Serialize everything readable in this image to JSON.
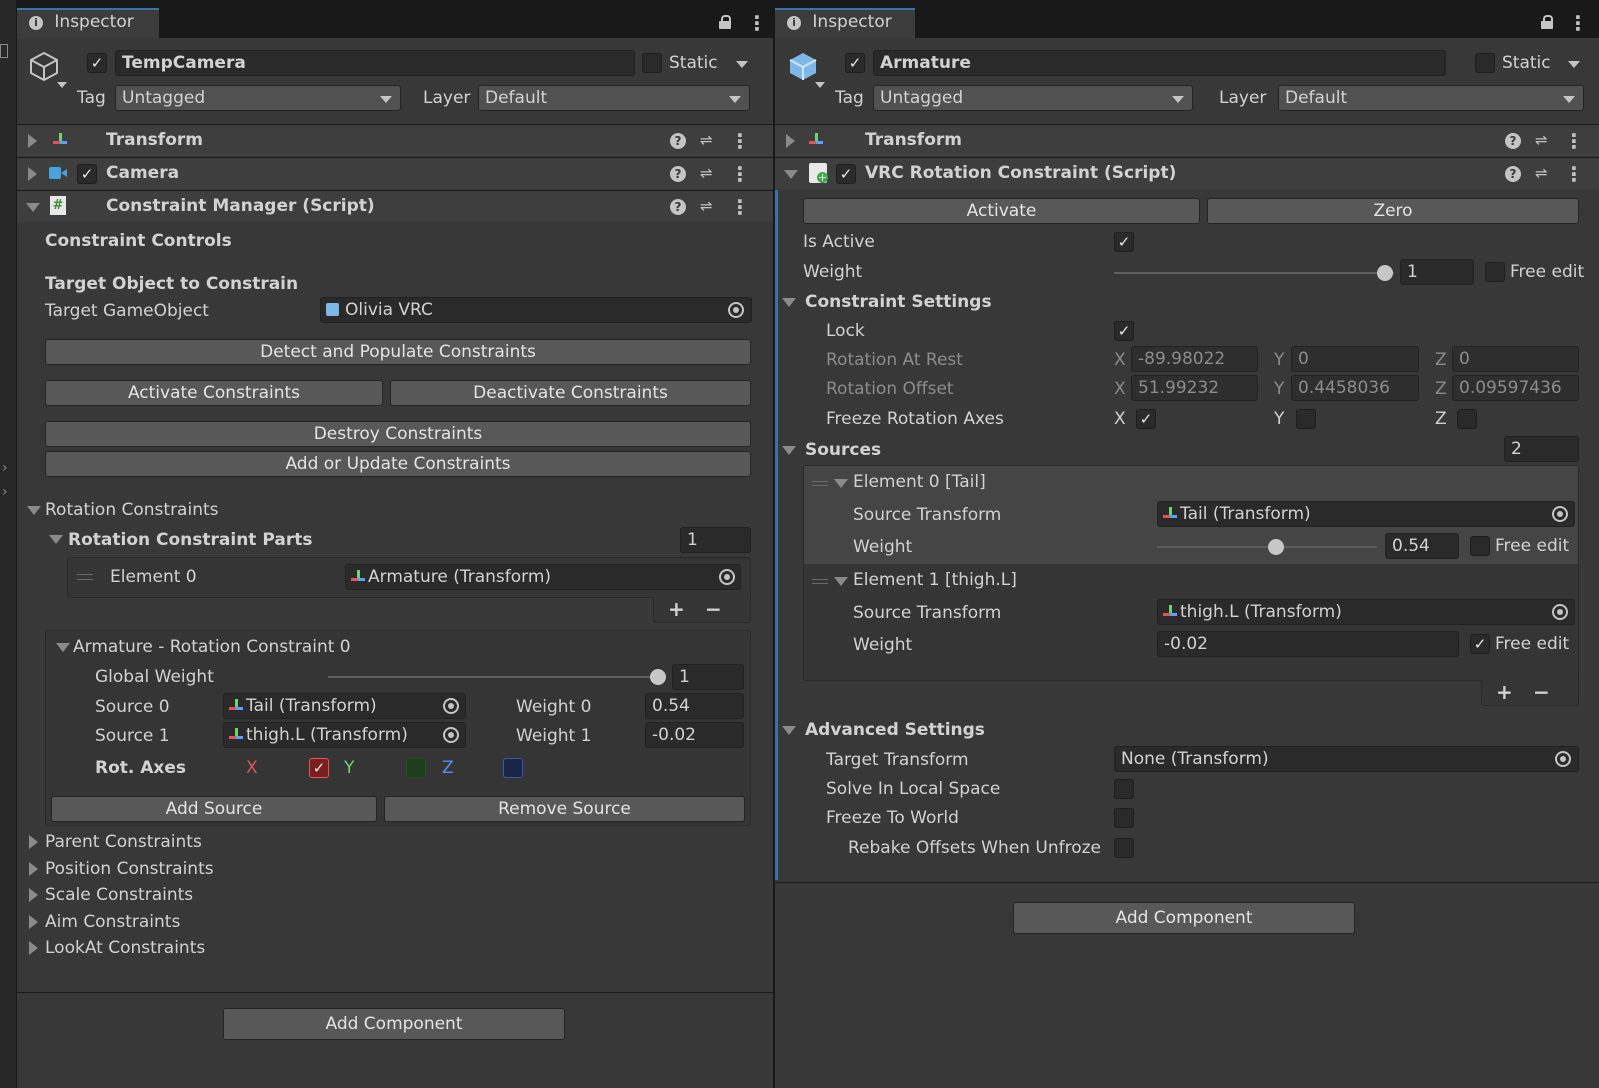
{
  "left": {
    "tab_label": "Inspector",
    "object_name": "TempCamera",
    "static_label": "Static",
    "tag_label": "Tag",
    "tag_value": "Untagged",
    "layer_label": "Layer",
    "layer_value": "Default",
    "components": {
      "transform": "Transform",
      "camera": "Camera",
      "constraint_manager": "Constraint Manager (Script)"
    },
    "constraint_controls": "Constraint Controls",
    "target_section": "Target Object to Constrain",
    "target_gameobject_label": "Target GameObject",
    "target_gameobject_value": "Olivia VRC",
    "btn_detect": "Detect and Populate Constraints",
    "btn_activate": "Activate Constraints",
    "btn_deactivate": "Deactivate Constraints",
    "btn_destroy": "Destroy Constraints",
    "btn_add_update": "Add or Update Constraints",
    "rotation_constraints": "Rotation Constraints",
    "rotation_parts": "Rotation Constraint Parts",
    "rotation_parts_count": "1",
    "element0_label": "Element 0",
    "element0_value": "Armature (Transform)",
    "plus": "+",
    "minus": "−",
    "armature_box": {
      "title": "Armature - Rotation Constraint 0",
      "global_weight_label": "Global Weight",
      "global_weight_value": "1",
      "global_weight_fraction": 1.0,
      "source0_label": "Source 0",
      "source0_value": "Tail (Transform)",
      "weight0_label": "Weight 0",
      "weight0_value": "0.54",
      "source1_label": "Source 1",
      "source1_value": "thigh.L (Transform)",
      "weight1_label": "Weight 1",
      "weight1_value": "-0.02",
      "rot_axes_label": "Rot. Axes",
      "x_label": "X",
      "y_label": "Y",
      "z_label": "Z",
      "x_checked": true,
      "btn_add_source": "Add Source",
      "btn_remove_source": "Remove Source"
    },
    "foldouts": [
      "Parent Constraints",
      "Position Constraints",
      "Scale Constraints",
      "Aim Constraints",
      "LookAt Constraints"
    ],
    "add_component": "Add Component"
  },
  "right": {
    "tab_label": "Inspector",
    "object_name": "Armature",
    "static_label": "Static",
    "tag_label": "Tag",
    "tag_value": "Untagged",
    "layer_label": "Layer",
    "layer_value": "Default",
    "components": {
      "transform": "Transform",
      "vrc_rotation": "VRC Rotation Constraint (Script)"
    },
    "btn_activate": "Activate",
    "btn_zero": "Zero",
    "is_active_label": "Is Active",
    "weight_label": "Weight",
    "weight_value": "1",
    "weight_fraction": 1.0,
    "free_edit": "Free edit",
    "constraint_settings": "Constraint Settings",
    "lock_label": "Lock",
    "rotation_at_rest_label": "Rotation At Rest",
    "rotation_at_rest": {
      "x": "-89.98022",
      "y": "0",
      "z": "0"
    },
    "rotation_offset_label": "Rotation Offset",
    "rotation_offset": {
      "x": "51.99232",
      "y": "0.4458036",
      "z": "0.09597436"
    },
    "freeze_axes_label": "Freeze Rotation Axes",
    "axis_x": "X",
    "axis_y": "Y",
    "axis_z": "Z",
    "sources_label": "Sources",
    "sources_count": "2",
    "element0": {
      "title": "Element 0 [Tail]",
      "source_transform_label": "Source Transform",
      "source_transform_value": "Tail (Transform)",
      "weight_label": "Weight",
      "weight_value": "0.54",
      "weight_fraction": 0.54,
      "free_edit": "Free edit"
    },
    "element1": {
      "title": "Element 1 [thigh.L]",
      "source_transform_label": "Source Transform",
      "source_transform_value": "thigh.L (Transform)",
      "weight_label": "Weight",
      "weight_value": "-0.02",
      "free_edit": "Free edit"
    },
    "plus": "+",
    "minus": "−",
    "advanced_settings": "Advanced Settings",
    "target_transform_label": "Target Transform",
    "target_transform_value": "None (Transform)",
    "solve_local_label": "Solve In Local Space",
    "freeze_world_label": "Freeze To World",
    "rebake_label": "Rebake Offsets When Unfroze",
    "add_component": "Add Component"
  },
  "colors": {
    "panel_bg": "#383838",
    "accent_blue": "#3a72b0",
    "axis_x": "#e05555",
    "axis_y": "#6fd36f",
    "axis_z": "#5a8cff"
  }
}
